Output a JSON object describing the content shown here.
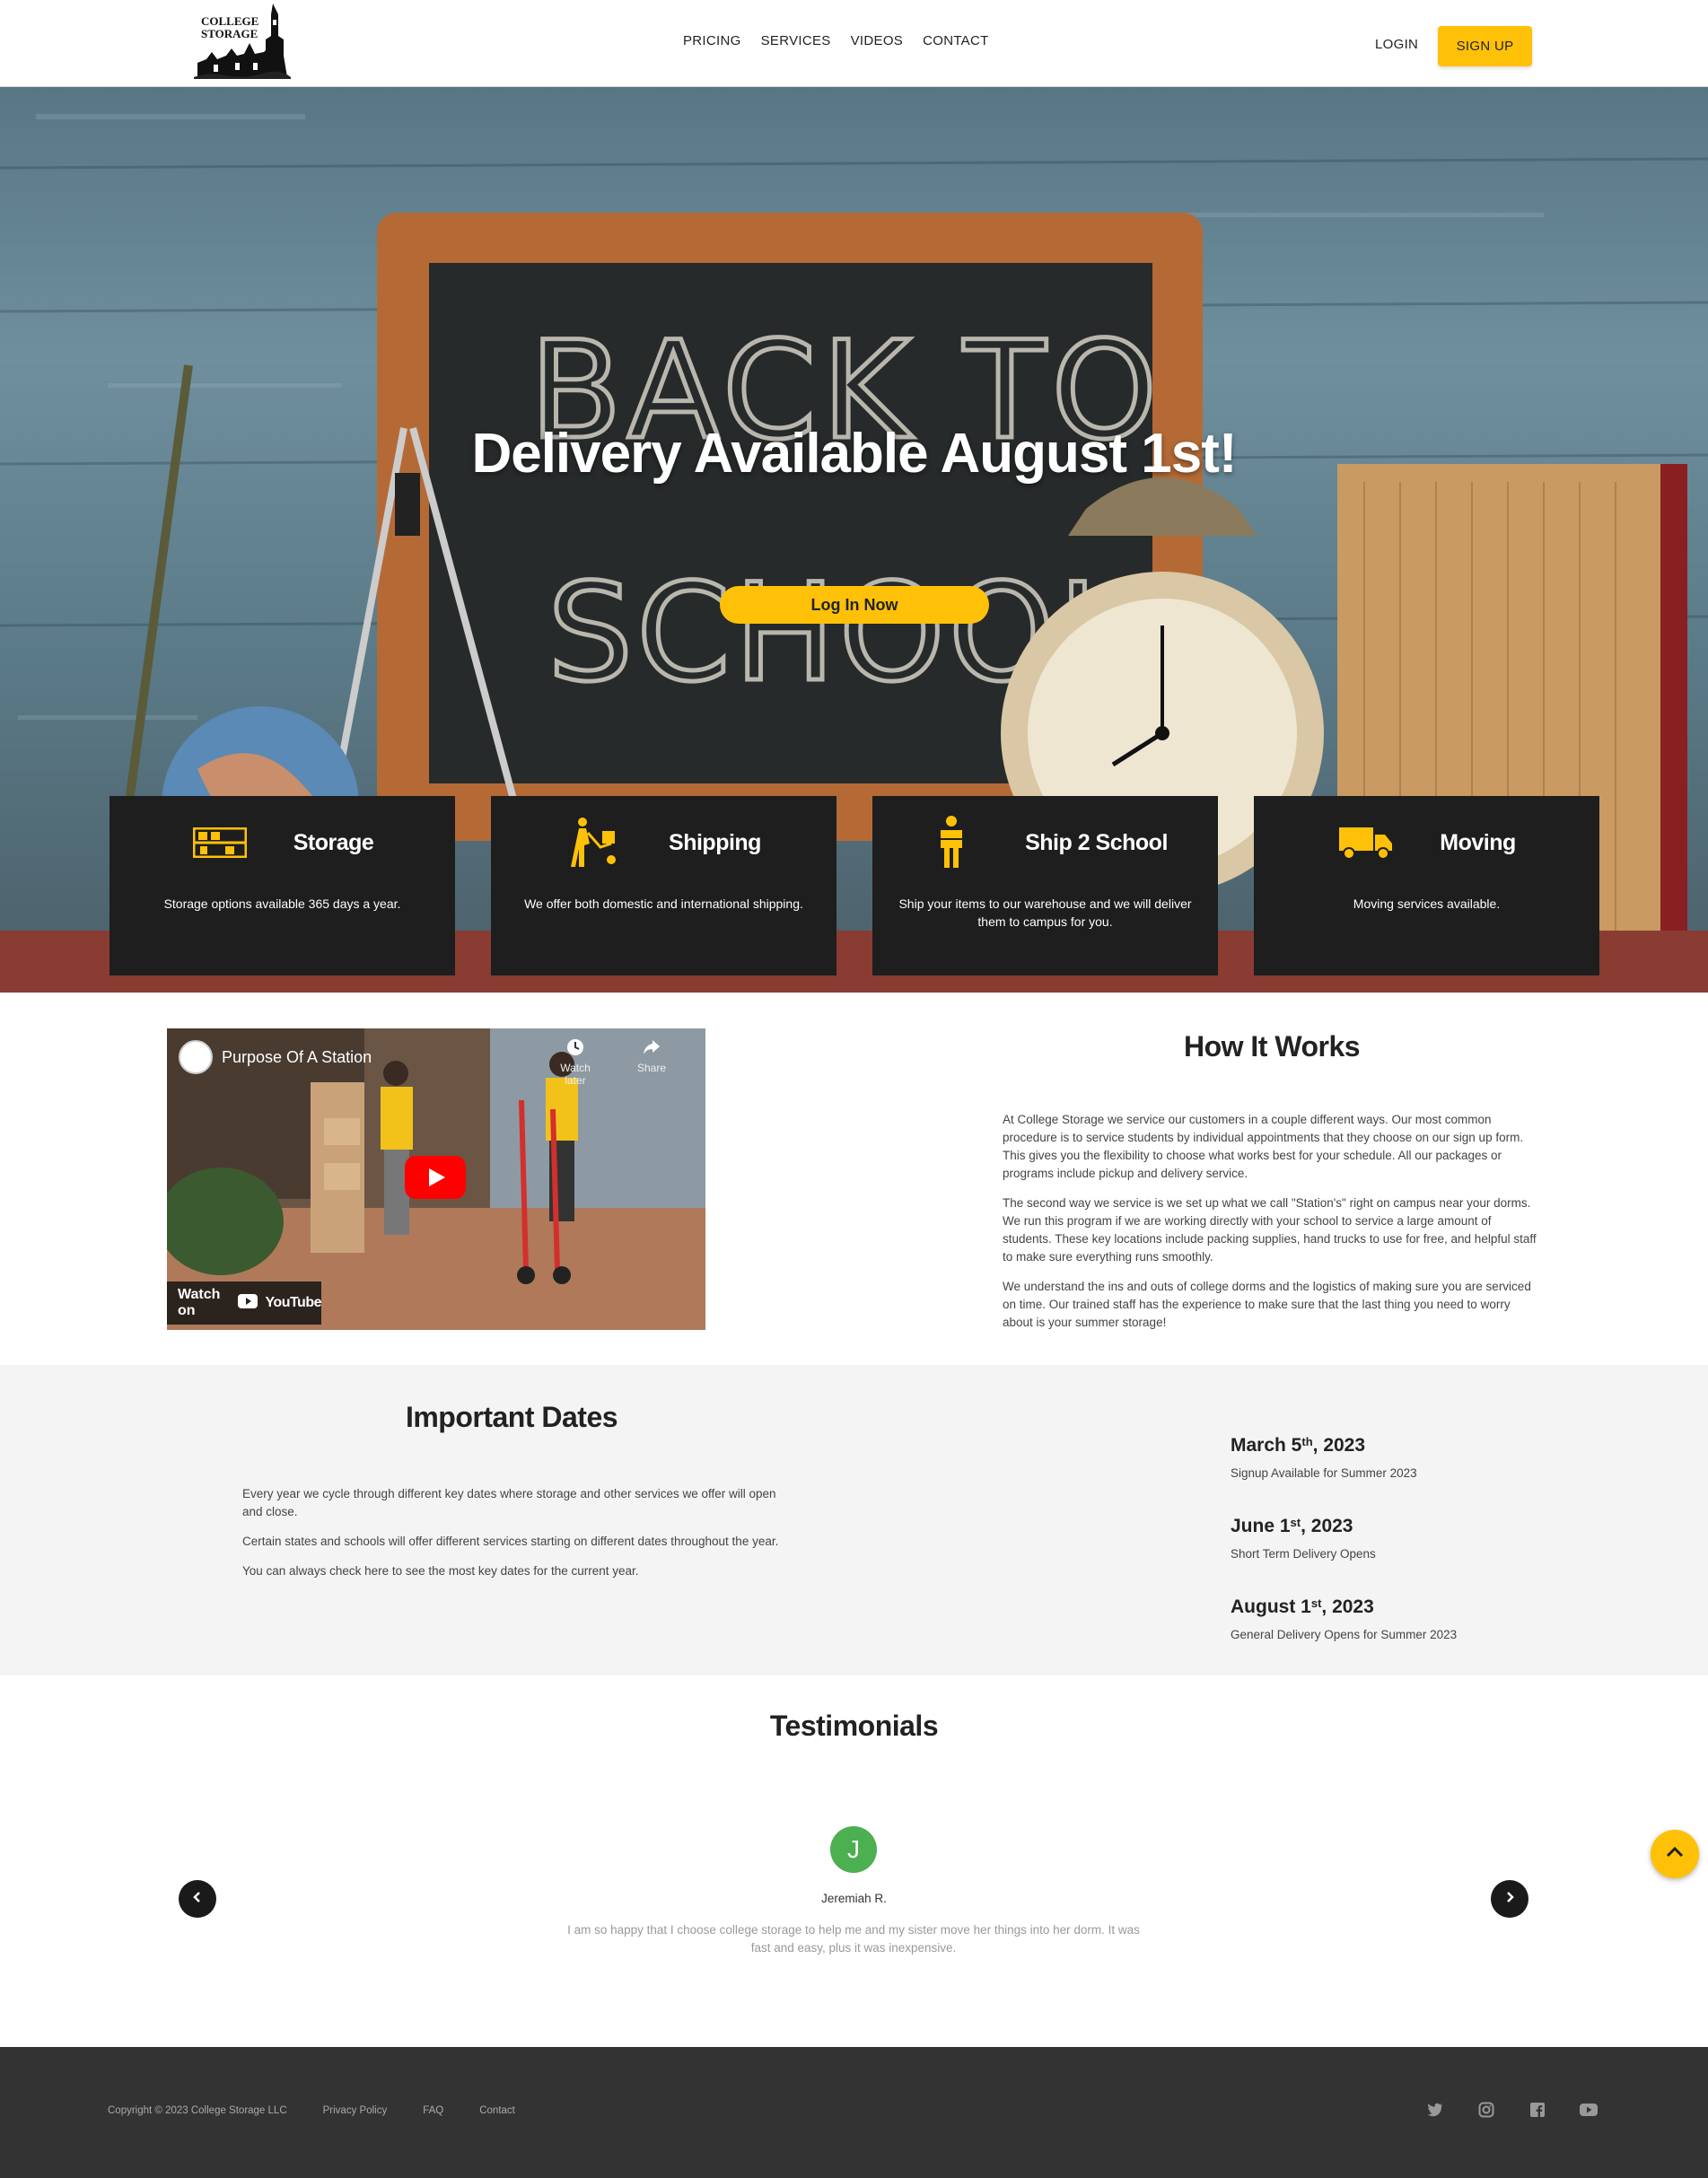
{
  "nav": {
    "logo_text": [
      "COLLEGE",
      "STORAGE"
    ],
    "menu": [
      "PRICING",
      "SERVICES",
      "VIDEOS",
      "CONTACT"
    ],
    "login": "LOGIN",
    "signup": "SIGN UP"
  },
  "hero": {
    "title": "Delivery Available August 1st!",
    "button": "Log In Now",
    "chalkboard_text": [
      "BACK TO",
      "SCHOOL!"
    ]
  },
  "cards": [
    {
      "title": "Storage",
      "text": "Storage options available 365 days a year.",
      "icon": "shelving-icon"
    },
    {
      "title": "Shipping",
      "text": "We offer both domestic and international shipping.",
      "icon": "hand-truck-icon"
    },
    {
      "title": "Ship 2 School",
      "text": "Ship your items to our warehouse and we will deliver them to campus for you.",
      "icon": "person-carrying-box-icon"
    },
    {
      "title": "Moving",
      "text": "Moving services available.",
      "icon": "truck-icon"
    }
  ],
  "video": {
    "title": "Purpose Of A Station",
    "watch_later": "Watch later",
    "share": "Share",
    "watch_on": "Watch on",
    "youtube": "YouTube"
  },
  "how_it_works": {
    "title": "How It Works",
    "paragraphs": [
      "At College Storage we service our customers in a couple different ways. Our most common procedure is to service students by individual appointments that they choose on our sign up form. This gives you the flexibility to choose what works best for your schedule. All our packages or programs include pickup and delivery service.",
      "The second way we service is we set up what we call \"Station's\" right on campus near your dorms. We run this program if we are working directly with your school to service a large amount of students. These key locations include packing supplies, hand trucks to use for free, and helpful staff to make sure everything runs smoothly.",
      "We understand the ins and outs of college dorms and the logistics of making sure you are serviced on time. Our trained staff has the experience to make sure that the last thing you need to worry about is your summer storage!"
    ]
  },
  "important_dates": {
    "title": "Important Dates",
    "paragraphs": [
      "Every year we cycle through different key dates where storage and other services we offer will open and close.",
      "Certain states and schools will offer different services starting on different dates throughout the year.",
      "You can always check here to see the most key dates for the current year."
    ],
    "dates": [
      {
        "month": "March 5",
        "suffix": "th",
        "year": ", 2023",
        "desc": "Signup Available for Summer 2023"
      },
      {
        "month": "June 1",
        "suffix": "st",
        "year": ", 2023",
        "desc": "Short Term Delivery Opens"
      },
      {
        "month": "August 1",
        "suffix": "st",
        "year": ", 2023",
        "desc": "General Delivery Opens for Summer 2023"
      }
    ]
  },
  "testimonials": {
    "title": "Testimonials",
    "initial": "J",
    "name": "Jeremiah R.",
    "quote": "I am so happy that I choose college storage to help me and my sister move her things into her dorm. It was fast and easy, plus it was inexpensive."
  },
  "footer": {
    "copyright": "Copyright © 2023 College Storage LLC",
    "links": [
      "Privacy Policy",
      "FAQ",
      "Contact"
    ],
    "social": [
      "twitter-icon",
      "instagram-icon",
      "facebook-icon",
      "youtube-icon"
    ]
  },
  "colors": {
    "accent": "#ffc107",
    "card_bg": "#1e1e1e",
    "footer_bg": "#333333",
    "dates_bg": "#f4f4f5",
    "avatar": "#4caf50"
  }
}
